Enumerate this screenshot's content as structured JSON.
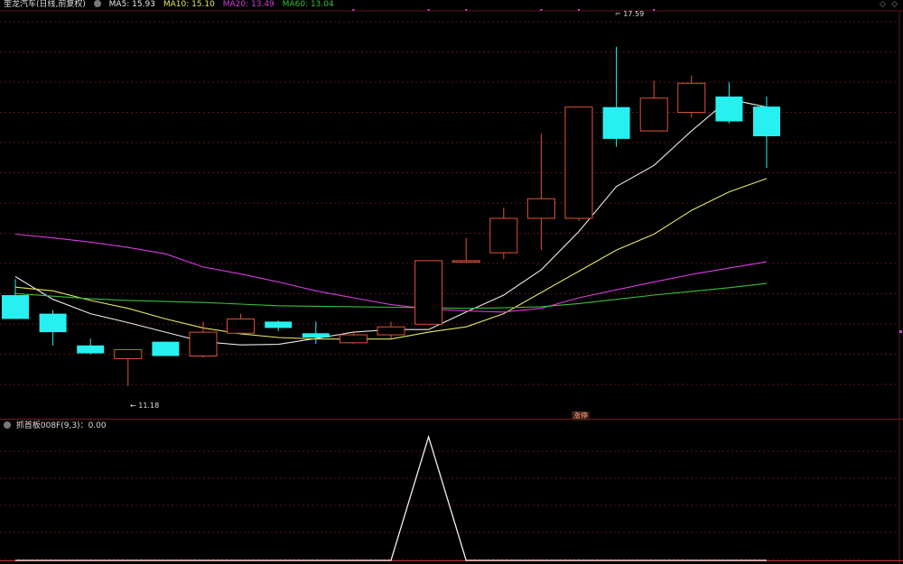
{
  "header": {
    "title": "奎龙汽车(日线,前复权)",
    "ma5": "MA5: 15.93",
    "ma10": "MA10: 15.10",
    "ma20": "MA20: 13.49",
    "ma60": "MA60: 13.04"
  },
  "indicator": {
    "label": "抓首板008F(9,3)：0.00"
  },
  "badge": "涨停",
  "annotations": {
    "high_label": "17.59",
    "low_label": "11.18"
  },
  "colors": {
    "up": "#e0533a",
    "down": "#27f0f0",
    "ma5": "#e8e8e8",
    "ma10": "#e6e665",
    "ma20": "#d83be0",
    "ma60": "#38c038",
    "grid": "#5a1616"
  },
  "chart_data": [
    {
      "type": "candlestick",
      "title": "奎龙汽车(日线,前复权)",
      "ylim": [
        10.6,
        18.2
      ],
      "candles": [
        {
          "open": 12.9,
          "high": 13.2,
          "low": 12.45,
          "close": 12.45
        },
        {
          "open": 12.55,
          "high": 12.62,
          "low": 11.95,
          "close": 12.2
        },
        {
          "open": 11.95,
          "high": 12.08,
          "low": 11.78,
          "close": 11.8
        },
        {
          "open": 11.7,
          "high": 11.88,
          "low": 11.18,
          "close": 11.87
        },
        {
          "open": 12.02,
          "high": 12.02,
          "low": 11.75,
          "close": 11.75
        },
        {
          "open": 11.75,
          "high": 12.4,
          "low": 11.72,
          "close": 12.2
        },
        {
          "open": 12.18,
          "high": 12.55,
          "low": 12.15,
          "close": 12.45
        },
        {
          "open": 12.4,
          "high": 12.42,
          "low": 12.22,
          "close": 12.28
        },
        {
          "open": 12.18,
          "high": 12.4,
          "low": 11.98,
          "close": 12.1
        },
        {
          "open": 12.0,
          "high": 12.22,
          "low": 11.98,
          "close": 12.15
        },
        {
          "open": 12.15,
          "high": 12.4,
          "low": 12.08,
          "close": 12.3
        },
        {
          "open": 12.35,
          "high": 13.55,
          "low": 12.35,
          "close": 13.55
        },
        {
          "open": 13.54,
          "high": 13.98,
          "low": 13.52,
          "close": 13.55
        },
        {
          "open": 13.7,
          "high": 14.55,
          "low": 13.58,
          "close": 14.35
        },
        {
          "open": 14.35,
          "high": 15.95,
          "low": 13.75,
          "close": 14.72
        },
        {
          "open": 14.35,
          "high": 16.45,
          "low": 14.3,
          "close": 16.45
        },
        {
          "open": 16.45,
          "high": 17.59,
          "low": 15.7,
          "close": 15.85
        },
        {
          "open": 16.0,
          "high": 16.95,
          "low": 16.0,
          "close": 16.62
        },
        {
          "open": 16.35,
          "high": 17.05,
          "low": 16.25,
          "close": 16.9
        },
        {
          "open": 16.65,
          "high": 16.92,
          "low": 16.14,
          "close": 16.18
        },
        {
          "open": 16.46,
          "high": 16.65,
          "low": 15.3,
          "close": 15.9
        }
      ],
      "series": [
        {
          "name": "MA5",
          "values": [
            13.25,
            12.82,
            12.55,
            12.38,
            12.2,
            12.02,
            11.96,
            11.97,
            12.08,
            12.2,
            12.25,
            12.25,
            12.58,
            12.9,
            13.38,
            14.1,
            14.95,
            15.35,
            16.0,
            16.6,
            16.45
          ]
        },
        {
          "name": "MA10",
          "values": [
            13.05,
            12.98,
            12.8,
            12.65,
            12.45,
            12.28,
            12.17,
            12.1,
            12.07,
            12.07,
            12.07,
            12.2,
            12.3,
            12.55,
            12.95,
            13.35,
            13.75,
            14.05,
            14.5,
            14.85,
            15.1
          ]
        },
        {
          "name": "MA20",
          "values": [
            14.05,
            13.98,
            13.9,
            13.8,
            13.68,
            13.43,
            13.3,
            13.15,
            12.98,
            12.85,
            12.72,
            12.64,
            12.6,
            12.58,
            12.65,
            12.85,
            13.0,
            13.15,
            13.29,
            13.41,
            13.53
          ]
        },
        {
          "name": "MA60",
          "values": [
            12.93,
            12.88,
            12.83,
            12.8,
            12.78,
            12.76,
            12.73,
            12.7,
            12.69,
            12.68,
            12.67,
            12.66,
            12.65,
            12.66,
            12.68,
            12.74,
            12.82,
            12.9,
            12.97,
            13.04,
            13.12
          ]
        }
      ]
    },
    {
      "type": "line",
      "title": "抓首板008F(9,3)",
      "ylim": [
        0,
        1
      ],
      "series": [
        {
          "name": "抓首板008F",
          "values": [
            0,
            0,
            0,
            0,
            0,
            0,
            0,
            0,
            0,
            0,
            0,
            1,
            0,
            0,
            0,
            0,
            0,
            0,
            0,
            0,
            0
          ]
        }
      ]
    }
  ]
}
